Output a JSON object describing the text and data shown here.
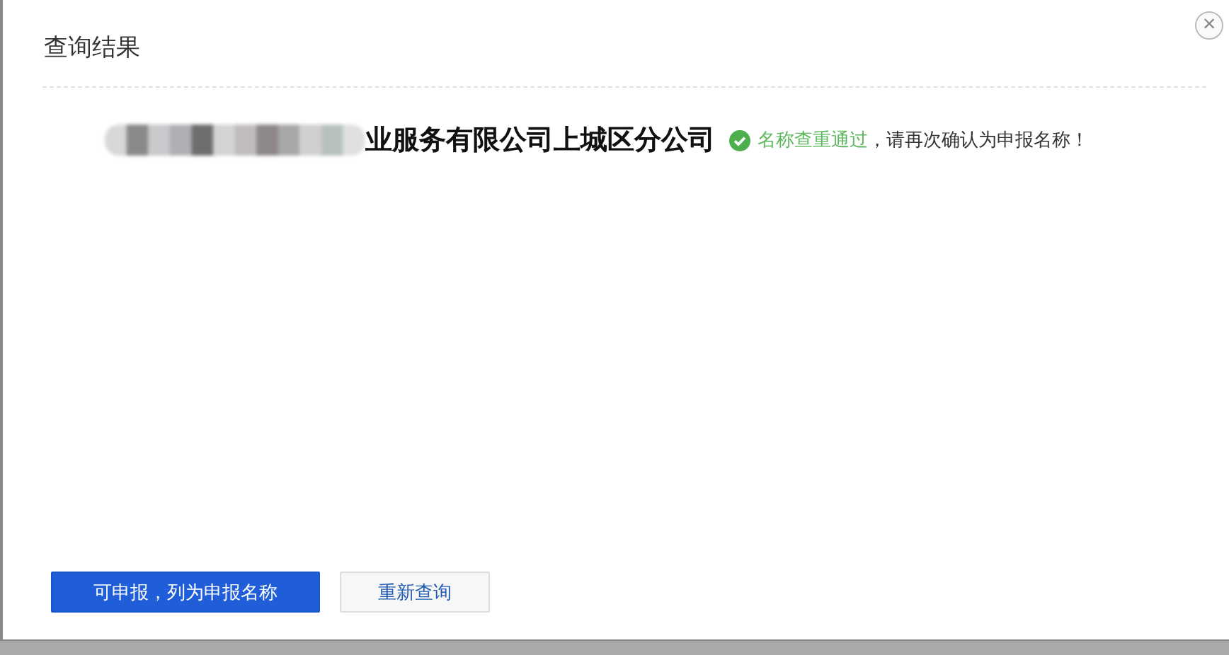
{
  "dialog": {
    "title": "查询结果",
    "close": "×"
  },
  "result": {
    "company_name_visible": "业服务有限公司上城区分公司",
    "status": "名称查重通过",
    "passed": true,
    "note": "，请再次确认为申报名称！"
  },
  "buttons": [
    {
      "label": "可申报，列为申报名称",
      "kind": "primary"
    },
    {
      "label": "重新查询",
      "kind": "secondary"
    }
  ]
}
